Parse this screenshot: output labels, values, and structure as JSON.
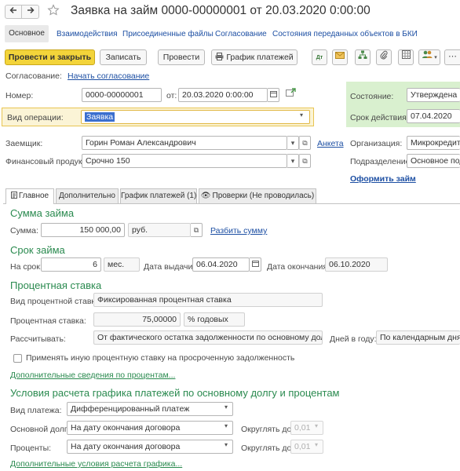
{
  "window": {
    "title": "Заявка на займ 0000-00000001 от 20.03.2020 0:00:00",
    "back_icon": "arrow-left-icon",
    "forward_icon": "arrow-right-icon",
    "star_icon": "star-icon"
  },
  "nav_tabs": [
    {
      "label": "Основное"
    },
    {
      "label": "Взаимодействия"
    },
    {
      "label": "Присоединенные файлы"
    },
    {
      "label": "Согласование"
    },
    {
      "label": "Состояния переданных объектов в БКИ"
    }
  ],
  "toolbar": {
    "post_close_label": "Провести и закрыть",
    "save_label": "Записать",
    "post_label": "Провести",
    "schedule_label": "График платежей",
    "print_icon": "printer-icon",
    "icons": [
      "dt-kt-icon",
      "envelope-icon",
      "structure-icon",
      "paperclip-icon",
      "grid-icon",
      "users-icon",
      "more-icon"
    ]
  },
  "approval": {
    "label": "Согласование:",
    "link": "Начать согласование"
  },
  "number": {
    "label": "Номер:",
    "value": "0000-00000001",
    "date_label": "от:",
    "date_value": "20.03.2020  0:00:00"
  },
  "operation": {
    "label": "Вид операции:",
    "value": "Заявка"
  },
  "status": {
    "label": "Состояние:",
    "value": "Утверждена",
    "validity_label": "Срок действия:",
    "validity_value": "07.04.2020"
  },
  "borrower": {
    "label": "Заемщик:",
    "value": "Горин Роман Александрович",
    "link": "Анкета"
  },
  "product": {
    "label": "Финансовый продукт:",
    "value": "Срочно 150"
  },
  "organization": {
    "label": "Организация:",
    "value": "Микрокредитна",
    "division_label": "Подразделение:",
    "division_value": "Основное подр",
    "issue_link": "Оформить займ"
  },
  "inner_tabs": [
    {
      "label": "Главное"
    },
    {
      "label": "Дополнительно"
    },
    {
      "label": "График платежей (1)"
    },
    {
      "label": "Проверки (Не проводилась)"
    }
  ],
  "loan_sum": {
    "title": "Сумма займа",
    "label": "Сумма:",
    "value": "150 000,00",
    "currency": "руб.",
    "split_link": "Разбить сумму"
  },
  "loan_term": {
    "title": "Срок займа",
    "term_label": "На срок:",
    "term_value": "6",
    "unit": "мес.",
    "issue_label": "Дата выдачи:",
    "issue_value": "06.04.2020",
    "end_label": "Дата окончания:",
    "end_value": "06.10.2020"
  },
  "rate": {
    "title": "Процентная ставка",
    "type_label": "Вид процентной ставки:",
    "type_value": "Фиксированная процентная ставка",
    "rate_label": "Процентная ставка:",
    "rate_value": "75,00000",
    "rate_unit": "% годовых",
    "calc_label": "Рассчитывать:",
    "calc_value": "От фактического остатка задолженности по основному долгу",
    "days_label": "Дней в году:",
    "days_value": "По календарным дням (",
    "overdue_checkbox": "Применять иную процентную ставку на просроченную задолженность",
    "overdue_checked": false,
    "extra_link": "Дополнительные сведения по процентам..."
  },
  "schedule": {
    "title": "Условия расчета графика платежей по основному долгу и процентам",
    "payment_label": "Вид платежа:",
    "payment_value": "Дифференцированный платеж",
    "principal_label": "Основной долг:",
    "principal_value": "На дату окончания договора",
    "round_label": "Округлять до:",
    "round_value": "0,01",
    "interest_label": "Проценты:",
    "interest_value": "На дату окончания договора",
    "round2_label": "Округлять до:",
    "round2_value": "0,01",
    "extra_link": "Дополнительные условия расчета графика..."
  }
}
